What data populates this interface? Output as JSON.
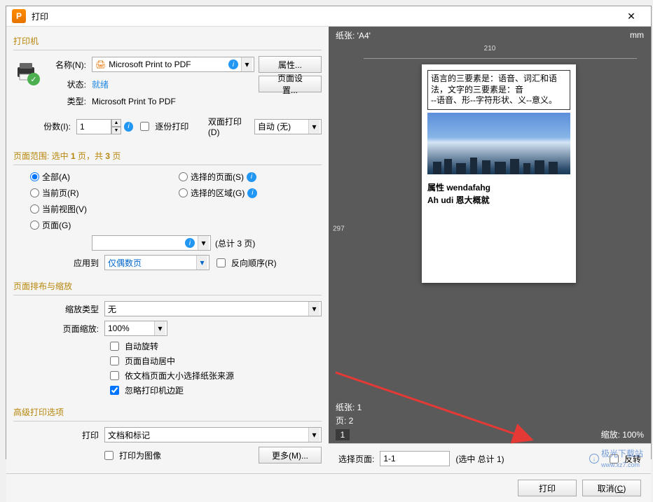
{
  "window": {
    "title": "打印",
    "close": "✕"
  },
  "printer_section": {
    "header": "打印机",
    "name_label": "名称(N):",
    "name_value": "Microsoft Print to PDF",
    "properties_btn": "属性...",
    "status_label": "状态:",
    "status_value": "就绪",
    "page_setup_btn": "页面设置...",
    "type_label": "类型:",
    "type_value": "Microsoft Print To PDF",
    "copies_label": "份数(I):",
    "copies_value": "1",
    "collate_label": "逐份打印",
    "duplex_label": "双面打印(D)",
    "duplex_value": "自动 (无)"
  },
  "range_section": {
    "header": "页面范围: 选中 1 页，共 3 页",
    "all": "全部(A)",
    "current_page": "当前页(R)",
    "current_view": "当前视图(V)",
    "pages": "页面(G)",
    "selected_pages": "选择的页面(S)",
    "selected_area": "选择的区域(G)",
    "total_pages": "(总计 3 页)",
    "apply_to_label": "应用到",
    "apply_to_value": "仅偶数页",
    "reverse_order": "反向顺序(R)"
  },
  "scaling_section": {
    "header": "页面排布与缩放",
    "scale_type_label": "缩放类型",
    "scale_type_value": "无",
    "page_scale_label": "页面缩放:",
    "page_scale_value": "100%",
    "auto_rotate": "自动旋转",
    "auto_center": "页面自动居中",
    "by_doc_size": "依文档页面大小选择纸张来源",
    "ignore_margins": "忽略打印机边距"
  },
  "advanced_section": {
    "header": "高级打印选项",
    "print_label": "打印",
    "print_value": "文档和标记",
    "print_as_image": "打印为图像",
    "more_btn": "更多(M)..."
  },
  "preview": {
    "paper_label": "纸张: 'A4'",
    "unit": "mm",
    "width": "210",
    "height": "297",
    "doc_line1": "语言的三要素是：语音、词汇和语法，文字的三要素是：音",
    "doc_line2": "--语音、形--字符形状、义--意义。",
    "doc_text1": "属性 wendafahg",
    "doc_text2": "Ah udi 恩大概就",
    "status_paper": "纸张: 1",
    "status_page": "页: 2",
    "status_tab": "1",
    "zoom": "缩放: 100%"
  },
  "bottom": {
    "select_page_label": "选择页面:",
    "select_page_value": "1-1",
    "select_total": "(选中   总计 1)",
    "reverse": "反转",
    "print_btn": "打印",
    "cancel_btn": "取消(C)"
  },
  "watermark": {
    "text": "极光下载站",
    "url": "www.xz7.com"
  }
}
